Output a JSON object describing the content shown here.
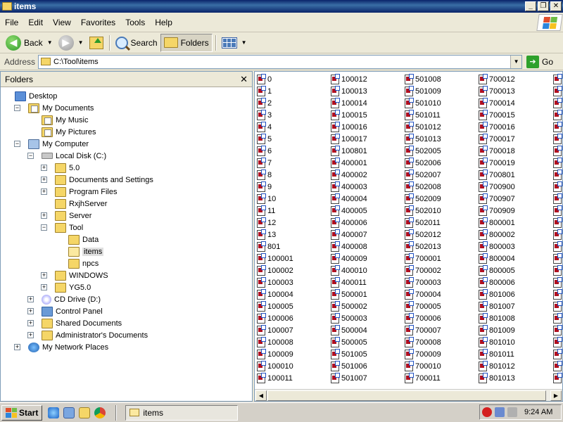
{
  "window": {
    "title": "items",
    "controls": {
      "minimize": "_",
      "restore": "❐",
      "close": "✕"
    }
  },
  "menu": [
    "File",
    "Edit",
    "View",
    "Favorites",
    "Tools",
    "Help"
  ],
  "toolbar": {
    "back": "Back",
    "search": "Search",
    "folders": "Folders"
  },
  "address": {
    "label": "Address",
    "value": "C:\\Tool\\items",
    "go": "Go"
  },
  "folders_pane": {
    "title": "Folders",
    "close": "✕",
    "tree": [
      {
        "label": "Desktop",
        "level": 0,
        "toggle": "",
        "icon": "desktop-icon"
      },
      {
        "label": "My Documents",
        "level": 1,
        "toggle": "−",
        "icon": "my-documents-icon"
      },
      {
        "label": "My Music",
        "level": 2,
        "toggle": "",
        "icon": "my-music-icon"
      },
      {
        "label": "My Pictures",
        "level": 2,
        "toggle": "",
        "icon": "my-pictures-icon"
      },
      {
        "label": "My Computer",
        "level": 1,
        "toggle": "−",
        "icon": "my-computer-icon"
      },
      {
        "label": "Local Disk (C:)",
        "level": 2,
        "toggle": "−",
        "icon": "hard-disk-icon"
      },
      {
        "label": "5.0",
        "level": 3,
        "toggle": "+",
        "icon": "folder-icon"
      },
      {
        "label": "Documents and Settings",
        "level": 3,
        "toggle": "+",
        "icon": "folder-icon"
      },
      {
        "label": "Program Files",
        "level": 3,
        "toggle": "+",
        "icon": "folder-icon"
      },
      {
        "label": "RxjhServer",
        "level": 3,
        "toggle": "",
        "icon": "folder-icon"
      },
      {
        "label": "Server",
        "level": 3,
        "toggle": "+",
        "icon": "folder-icon"
      },
      {
        "label": "Tool",
        "level": 3,
        "toggle": "−",
        "icon": "folder-icon"
      },
      {
        "label": "Data",
        "level": 4,
        "toggle": "",
        "icon": "folder-icon"
      },
      {
        "label": "items",
        "level": 4,
        "toggle": "",
        "icon": "open-folder-icon",
        "selected": true
      },
      {
        "label": "npcs",
        "level": 4,
        "toggle": "",
        "icon": "folder-icon"
      },
      {
        "label": "WINDOWS",
        "level": 3,
        "toggle": "+",
        "icon": "folder-icon"
      },
      {
        "label": "YG5.0",
        "level": 3,
        "toggle": "+",
        "icon": "folder-icon"
      },
      {
        "label": "CD Drive (D:)",
        "level": 2,
        "toggle": "+",
        "icon": "cd-drive-icon"
      },
      {
        "label": "Control Panel",
        "level": 2,
        "toggle": "+",
        "icon": "control-panel-icon"
      },
      {
        "label": "Shared Documents",
        "level": 2,
        "toggle": "+",
        "icon": "folder-icon"
      },
      {
        "label": "Administrator's Documents",
        "level": 2,
        "toggle": "+",
        "icon": "folder-icon"
      },
      {
        "label": "My Network Places",
        "level": 1,
        "toggle": "+",
        "icon": "network-places-icon"
      }
    ]
  },
  "files": {
    "columns": [
      [
        "0",
        "1",
        "2",
        "3",
        "4",
        "5",
        "6",
        "7",
        "8",
        "9",
        "10",
        "11",
        "12",
        "13",
        "801",
        "100001",
        "100002",
        "100003",
        "100004",
        "100005",
        "100006",
        "100007",
        "100008",
        "100009",
        "100010",
        "100011"
      ],
      [
        "100012",
        "100013",
        "100014",
        "100015",
        "100016",
        "100017",
        "100801",
        "400001",
        "400002",
        "400003",
        "400004",
        "400005",
        "400006",
        "400007",
        "400008",
        "400009",
        "400010",
        "400011",
        "500001",
        "500002",
        "500003",
        "500004",
        "500005",
        "501005",
        "501006",
        "501007"
      ],
      [
        "501008",
        "501009",
        "501010",
        "501011",
        "501012",
        "501013",
        "502005",
        "502006",
        "502007",
        "502008",
        "502009",
        "502010",
        "502011",
        "502012",
        "502013",
        "700001",
        "700002",
        "700003",
        "700004",
        "700005",
        "700006",
        "700007",
        "700008",
        "700009",
        "700010",
        "700011"
      ],
      [
        "700012",
        "700013",
        "700014",
        "700015",
        "700016",
        "700017",
        "700018",
        "700019",
        "700801",
        "700900",
        "700907",
        "700909",
        "800001",
        "800002",
        "800003",
        "800004",
        "800005",
        "800006",
        "801006",
        "801007",
        "801008",
        "801009",
        "801010",
        "801011",
        "801012",
        "801013"
      ]
    ]
  },
  "taskbar": {
    "start": "Start",
    "task": "items",
    "clock": "9:24 AM"
  }
}
